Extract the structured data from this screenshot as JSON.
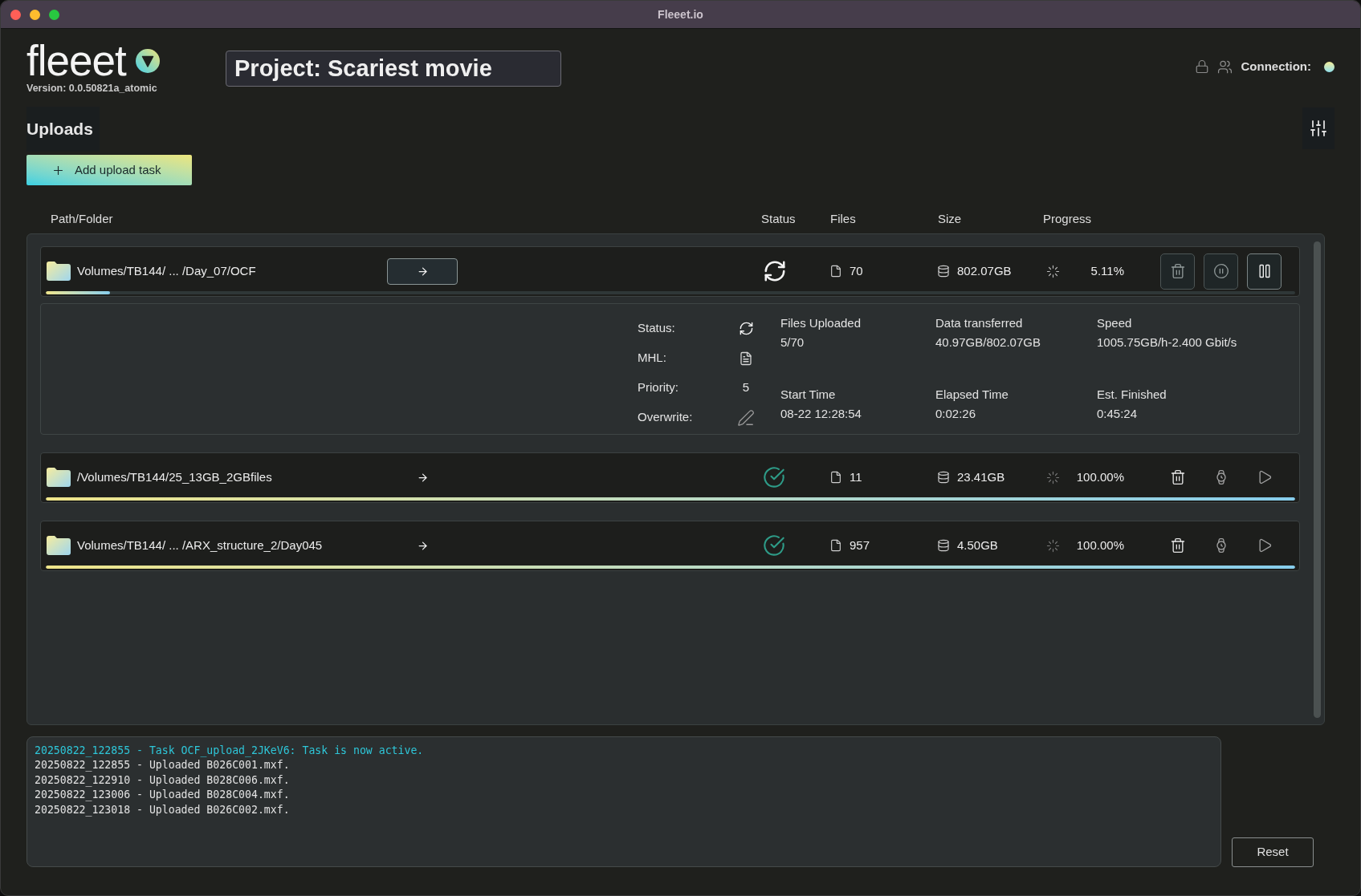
{
  "window": {
    "title": "Fleeet.io"
  },
  "header": {
    "logo": "fleeet",
    "version": "Version: 0.0.50821a_atomic",
    "project": "Project: Scariest movie",
    "connection_label": "Connection:",
    "connected": true
  },
  "uploads": {
    "title": "Uploads",
    "add_button": "Add upload task"
  },
  "table": {
    "columns": [
      "Path/Folder",
      "Status",
      "Files",
      "Size",
      "Progress"
    ],
    "rows": [
      {
        "path": "Volumes/TB144/ ... /Day_07/OCF",
        "kind": "active",
        "files": "70",
        "size": "802.07GB",
        "progress": "5.11%",
        "level": 0.0511,
        "expanded": true,
        "details": {
          "fields": [
            {
              "label": "Status:",
              "kind": "status"
            },
            {
              "label": "MHL:",
              "kind": "file"
            },
            {
              "label": "Priority:",
              "kind": "text",
              "value": "5"
            },
            {
              "label": "Overwrite:",
              "kind": "edit"
            }
          ],
          "stats": [
            {
              "label": "Files Uploaded",
              "value": "5/70"
            },
            {
              "label": "Data transferred",
              "value": "40.97GB/802.07GB"
            },
            {
              "label": "Speed",
              "value": "1005.75GB/h-2.400 Gbit/s"
            },
            {
              "label": "Start Time",
              "value": "08-22 12:28:54"
            },
            {
              "label": "Elapsed Time",
              "value": "0:02:26"
            },
            {
              "label": "Est. Finished",
              "value": "0:45:24"
            }
          ]
        }
      },
      {
        "path": "/Volumes/TB144/25_13GB_2GBfiles",
        "kind": "done",
        "files": "11",
        "size": "23.41GB",
        "progress": "100.00%",
        "level": 1,
        "expanded": false
      },
      {
        "path": "Volumes/TB144/ ... /ARX_structure_2/Day045",
        "kind": "done",
        "files": "957",
        "size": "4.50GB",
        "progress": "100.00%",
        "level": 1,
        "expanded": false
      }
    ]
  },
  "log": {
    "lines": [
      {
        "text": "20250822_122855 - Task OCF_upload_2JKeV6: Task is now active.",
        "kind": "event"
      },
      {
        "text": "20250822_122855 - Uploaded B026C001.mxf.",
        "kind": "info"
      },
      {
        "text": "20250822_122910 - Uploaded B028C006.mxf.",
        "kind": "info"
      },
      {
        "text": "20250822_123006 - Uploaded B028C004.mxf.",
        "kind": "info"
      },
      {
        "text": "20250822_123018 - Uploaded B026C002.mxf.",
        "kind": "info"
      }
    ]
  },
  "reset_button": "Reset"
}
